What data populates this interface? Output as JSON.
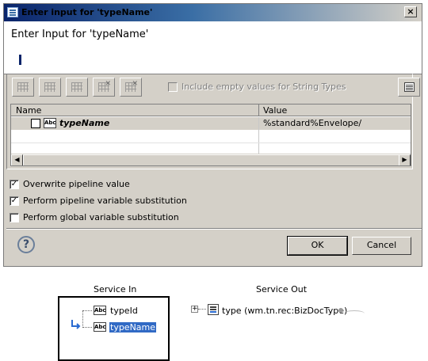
{
  "dialog": {
    "title": "Enter input for 'typeName'",
    "close_glyph": "×",
    "header_title": "Enter Input for 'typeName'",
    "include_empty_label": "Include empty values for String Types",
    "table": {
      "columns": [
        "Name",
        "Value"
      ],
      "rows": [
        {
          "name": "typeName",
          "value": "%standard%Envelope/",
          "type_badge": "Abc"
        }
      ]
    },
    "options": [
      {
        "label": "Overwrite pipeline value",
        "checked": true
      },
      {
        "label": "Perform pipeline variable substitution",
        "checked": true
      },
      {
        "label": "Perform global variable substitution",
        "checked": false
      }
    ],
    "ok_label": "OK",
    "cancel_label": "Cancel",
    "help_glyph": "?"
  },
  "canvas": {
    "service_in_label": "Service In",
    "service_out_label": "Service Out",
    "service_in_fields": [
      {
        "name": "typeId",
        "badge": "Abc"
      },
      {
        "name": "typeName",
        "badge": "Abc"
      }
    ],
    "service_out_fields": [
      {
        "name": "type (wm.tn.rec:BizDocType)",
        "expander": "+"
      }
    ]
  },
  "icons": [
    "window-icon",
    "close-icon",
    "add-row-icon",
    "insert-row-icon",
    "duplicate-row-icon",
    "delete-row-icon",
    "clear-icon",
    "columns-icon",
    "help-icon",
    "string-type-icon",
    "record-icon",
    "map-arrow-icon"
  ]
}
